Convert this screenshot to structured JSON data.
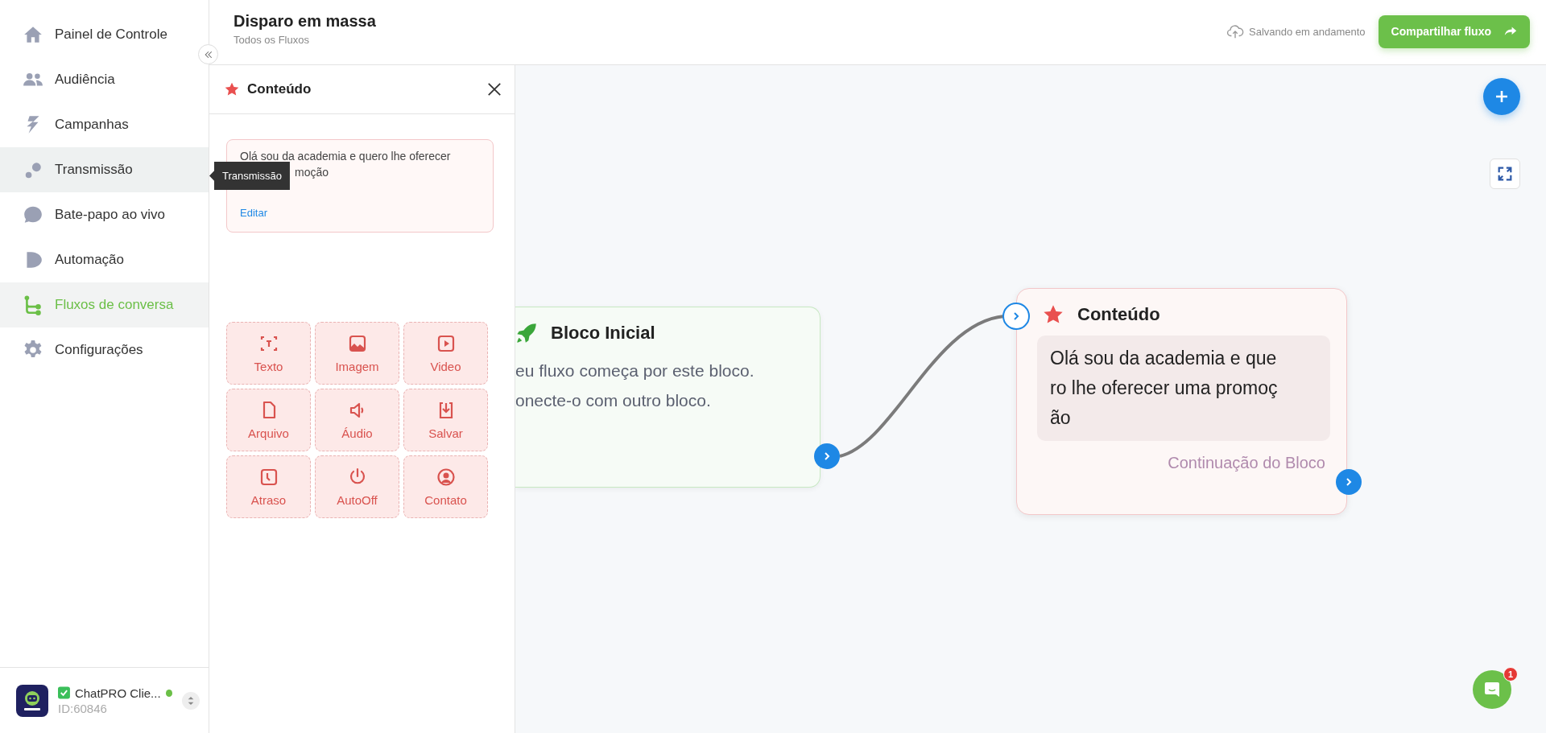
{
  "sidebar": {
    "items": [
      {
        "label": "Painel de Controle",
        "selected": false,
        "hovered": false
      },
      {
        "label": "Audiência",
        "selected": false,
        "hovered": false
      },
      {
        "label": "Campanhas",
        "selected": false,
        "hovered": false
      },
      {
        "label": "Transmissão",
        "selected": false,
        "hovered": true
      },
      {
        "label": "Bate-papo ao vivo",
        "selected": false,
        "hovered": false
      },
      {
        "label": "Automação",
        "selected": false,
        "hovered": false
      },
      {
        "label": "Fluxos de conversa",
        "selected": true,
        "hovered": false
      },
      {
        "label": "Configurações",
        "selected": false,
        "hovered": false
      }
    ],
    "account": {
      "name": "ChatPRO Clie...",
      "id": "ID:60846",
      "verified": true,
      "online": true
    }
  },
  "tooltip": "Transmissão",
  "header": {
    "title": "Disparo em massa",
    "breadcrumb": "Todos os Fluxos",
    "save_status": "Salvando em andamento",
    "share_button": "Compartilhar fluxo"
  },
  "panel": {
    "title": "Conteúdo",
    "message_lines": [
      "Olá sou da academia e quero lhe oferecer",
      "moção"
    ],
    "edit_link": "Editar",
    "blocks": [
      {
        "label": "Texto"
      },
      {
        "label": "Imagem"
      },
      {
        "label": "Video"
      },
      {
        "label": "Arquivo"
      },
      {
        "label": "Áudio"
      },
      {
        "label": "Salvar"
      },
      {
        "label": "Atraso"
      },
      {
        "label": "AutoOff"
      },
      {
        "label": "Contato"
      }
    ]
  },
  "canvas": {
    "nodes": [
      {
        "kind": "start",
        "title": "Bloco Inicial",
        "lines": [
          "eu fluxo começa por este bloco.",
          "onecte-o com outro bloco."
        ]
      },
      {
        "kind": "content",
        "title": "Conteúdo",
        "message": "Olá sou da academia e quero lhe oferecer uma promoção",
        "continuation": "Continuação do Bloco"
      }
    ]
  },
  "chat_badge": "1"
}
